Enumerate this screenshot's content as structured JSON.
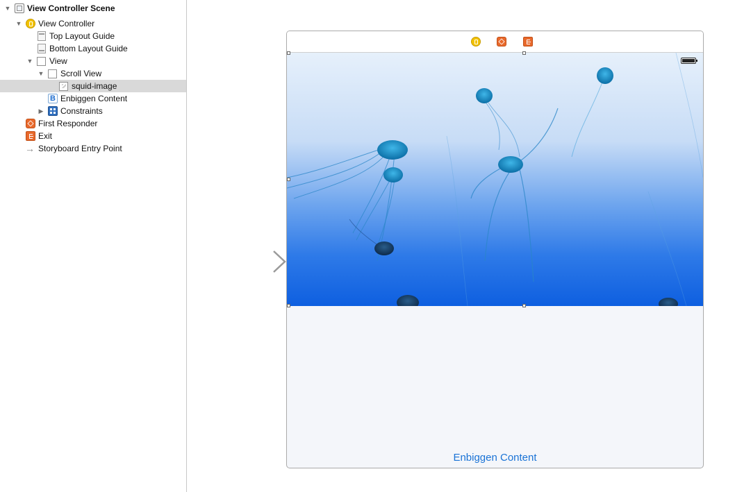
{
  "outline": {
    "items": [
      {
        "label": "View Controller Scene",
        "bold": true,
        "disclosure": "expanded",
        "icon": "scene-icon"
      },
      {
        "label": "View Controller",
        "disclosure": "expanded",
        "icon": "view-controller-icon"
      },
      {
        "label": "Top Layout Guide",
        "icon": "top-layout-guide-icon"
      },
      {
        "label": "Bottom Layout Guide",
        "icon": "bottom-layout-guide-icon"
      },
      {
        "label": "View",
        "disclosure": "expanded",
        "icon": "view-icon"
      },
      {
        "label": "Scroll View",
        "disclosure": "expanded",
        "icon": "scroll-view-icon"
      },
      {
        "label": "squid-image",
        "selected": true,
        "icon": "image-view-icon"
      },
      {
        "label": "Enbiggen Content",
        "icon": "button-icon",
        "icon_glyph": "B"
      },
      {
        "label": "Constraints",
        "disclosure": "collapsed",
        "icon": "constraints-icon"
      },
      {
        "label": "First Responder",
        "icon": "first-responder-icon"
      },
      {
        "label": "Exit",
        "icon": "exit-icon"
      },
      {
        "label": "Storyboard Entry Point",
        "icon": "entry-point-arrow-icon",
        "icon_glyph": "→"
      }
    ]
  },
  "canvas": {
    "content_button_label": "Enbiggen Content",
    "dock_icons": [
      "view-controller-icon",
      "first-responder-icon",
      "exit-icon"
    ],
    "image": "squid-jellyfish-photo"
  },
  "colors": {
    "accent_blue": "#1a73d6",
    "selection_gray": "#d9d9d9",
    "view_controller_yellow": "#f2c200",
    "responder_orange": "#e8692c",
    "jellyfish_blue": "#1f7bd6"
  }
}
